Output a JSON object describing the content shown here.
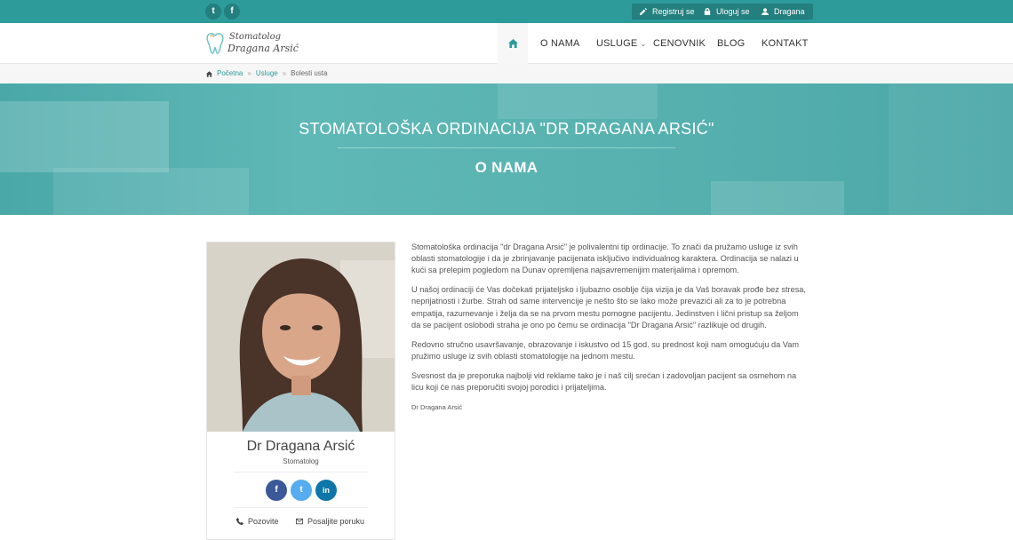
{
  "topbar": {
    "social": [
      {
        "icon": "twitter-icon",
        "glyph": "t"
      },
      {
        "icon": "facebook-icon",
        "glyph": "f"
      }
    ],
    "register_label": "Registruj se",
    "login_label": "Uloguj se",
    "user_label": "Dragana"
  },
  "logo": {
    "line1": "Stomatolog",
    "line2": "Dragana Arsić"
  },
  "nav": {
    "items": [
      "O NAMA",
      "USLUGE",
      "CENOVNIK",
      "BLOG",
      "KONTAKT"
    ]
  },
  "breadcrumb": {
    "items": [
      "Početna",
      "Usluge",
      "Bolesti usta"
    ],
    "separator": "»"
  },
  "hero": {
    "title": "STOMATOLOŠKA ORDINACIJA \"DR DRAGANA ARSIĆ\"",
    "subtitle": "O NAMA"
  },
  "profile": {
    "name": "Dr Dragana Arsić",
    "role": "Stomatolog",
    "social": [
      {
        "icon": "facebook-icon",
        "glyph": "f",
        "color": "#3b5998"
      },
      {
        "icon": "twitter-icon",
        "glyph": "t",
        "color": "#55acee"
      },
      {
        "icon": "linkedin-icon",
        "glyph": "in",
        "color": "#0e76a8"
      }
    ],
    "call_label": "Pozovite",
    "message_label": "Posaljite poruku"
  },
  "content": {
    "paragraphs": [
      "Stomatološka ordinacija \"dr Dragana Arsić\" je polivalentni tip ordinacije. To znači da pružamo usluge iz svih oblasti stomatologije i da je zbrinjavanje pacijenata isključivo individualnog karaktera. Ordinacija se nalazi u kući sa prelepim pogledom na Dunav opremljena najsavremenijim materijalima i opremom.",
      "U našoj ordinaciji će Vas dočekati prijateljsko i ljubazno osoblje čija vizija je da Vaš boravak prođe bez stresa, neprijatnosti i žurbe. Strah od same intervencije je nešto što se lako može prevazići ali za to je potrebna empatija, razumevanje i želja da se na prvom mestu pomogne pacijentu. Jedinstven i lični pristup sa željom da se pacijent oslobodi straha je ono po čemu se ordinacija \"Dr Dragana Arsić\" razlikuje od drugih.",
      "Redovno stručno usavršavanje, obrazovanje i iskustvo od 15 god. su prednost koji nam omogućuju da Vam pružimo usluge iz svih oblasti stomatologije na jednom mestu.",
      "Svesnost da je preporuka najbolji vid reklame tako je i naš cilj srećan i zadovoljan pacijent sa osmehom na licu koji će nas preporučiti svojoj porodici i prijateljima."
    ],
    "signature": "Dr Dragana Arsić"
  },
  "colors": {
    "accent": "#2e9b9b",
    "accent_dark": "#247f7f",
    "hero": "#55b1b0"
  }
}
